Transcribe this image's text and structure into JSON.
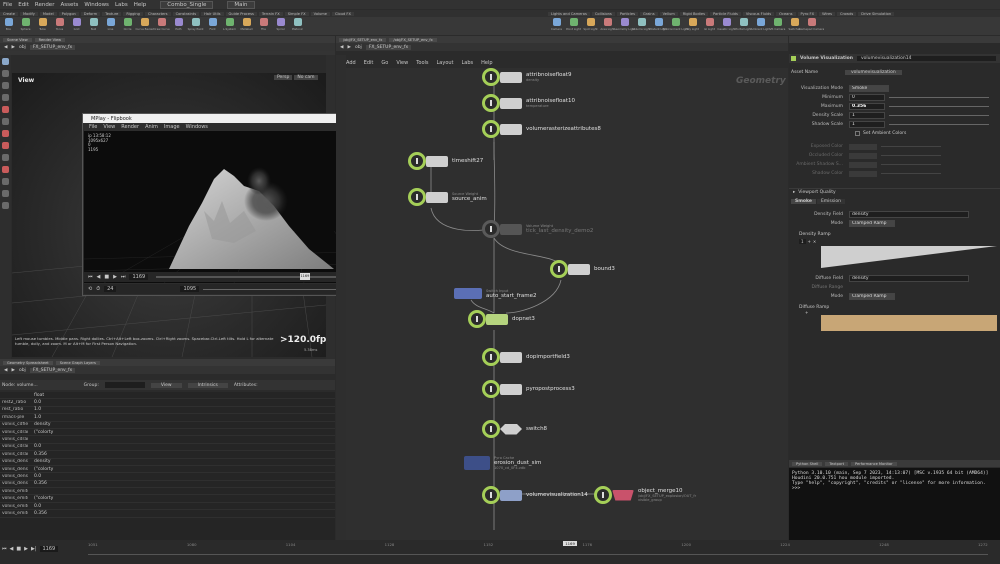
{
  "menubar": {
    "items": [
      "File",
      "Edit",
      "Render",
      "Assets",
      "Windows",
      "Labs",
      "Help"
    ],
    "desktop": "Combo_Single",
    "workspace": "Main"
  },
  "shelf_left": {
    "tabs": [
      "Create",
      "Modify",
      "Model",
      "Polygon",
      "Deform",
      "Texture",
      "Rigging",
      "Characters",
      "Constraints",
      "Hair Utils",
      "Guide Process",
      "Terrain FX",
      "Simple FX",
      "Volume",
      "Cloud FX"
    ],
    "tools": [
      "Box",
      "Sphere",
      "Tube",
      "Torus",
      "Grid",
      "Null",
      "Line",
      "Circle",
      "Curve Bezier",
      "Draw Curve",
      "Path",
      "Spray Paint",
      "Font",
      "L-System",
      "Metaball",
      "File",
      "Spiral",
      "Platonic"
    ]
  },
  "shelf_right": {
    "tabs": [
      "Lights and Cameras",
      "Collisions",
      "Particles",
      "Grains",
      "Vellum",
      "Rigid Bodies",
      "Particle Fluids",
      "Viscous Fluids",
      "Oceans",
      "Pyro FX",
      "Wires",
      "Crowds",
      "Drive Simulation"
    ],
    "tools": [
      "Camera",
      "Point Light",
      "Spot Light",
      "Area Light",
      "Geometry Light",
      "Volume Light",
      "Distant Light",
      "Environment Light",
      "Sky Light",
      "GI Light",
      "Caustic Light",
      "Portal Light",
      "Ambient Light",
      "VR Camera",
      "Switcher",
      "Gamepad Camera"
    ]
  },
  "left_pane": {
    "tabs": [
      "Scene View",
      "Render View"
    ],
    "path_root": "obj",
    "path_net": "FX_SETUP_env_fx",
    "view_title": "View",
    "persp": "Persp",
    "nocam": "No cam",
    "hint": "Left mouse tumbles. Middle pans. Right dollies. Ctrl+Alt+Left box-zooms. Ctrl+Right zooms. Spacebar-Ctrl-Left tilts. Hold L for alternate tumble, dolly, and zoom. M or Alt+M for First Person Navigation.",
    "fps": ">120.0fps",
    "fps_sub": "5.38ms"
  },
  "flipbook": {
    "title": "MPlay - Flipbook",
    "menu": [
      "File",
      "View",
      "Render",
      "Anim",
      "Image",
      "Windows"
    ],
    "info": [
      "ip 13:58:12",
      "1095x627",
      "0",
      "1195"
    ],
    "frame": "1169",
    "frame_fine": "1169",
    "step": "24",
    "start": "1095",
    "end": "1156"
  },
  "spreadsheet": {
    "tabs": [
      "Geometry Spreadsheet",
      "Scene Graph Layers"
    ],
    "path_root": "obj",
    "path_net": "FX_SETUP_env_fx",
    "node_label": "Node: volume...",
    "group_label": "Group:",
    "view_label": "View",
    "intrinsics_label": "Intrinsics",
    "attributes_label": "Attributes:",
    "type_col": "float",
    "rows": [
      [
        "rest2_ratio",
        "0.0"
      ],
      [
        "rest_ratio",
        "1.0"
      ],
      [
        "rmacs-ple",
        "1.0"
      ],
      [
        "volvis_cdfield",
        "density"
      ],
      [
        "volvis_cdramp",
        "(\"colorty"
      ],
      [
        "volvis_cdrampr",
        ""
      ],
      [
        "volvis_cdrangel",
        "0.0"
      ],
      [
        "volvis_cdrangel",
        "0.356"
      ],
      [
        "volvis_densityfi",
        "density"
      ],
      [
        "volvis_densityra",
        "(\"colorty"
      ],
      [
        "volvis_densityra",
        "0.0"
      ],
      [
        "volvis_densityra",
        "0.356"
      ],
      [
        "volvis_emitcdfie",
        ""
      ],
      [
        "volvis_emitcdra",
        "(\"colorty"
      ],
      [
        "volvis_emitcdra",
        "0.0"
      ],
      [
        "volvis_emitcdra",
        "0.356"
      ]
    ]
  },
  "network": {
    "tabs": [
      "/obj/FX_SETUP_env_fx",
      "/obj/FX_SETUP_env_fx"
    ],
    "path_root": "obj",
    "path_net": "FX_SETUP_env_fx",
    "menu": [
      "Add",
      "Edit",
      "Go",
      "View",
      "Tools",
      "Layout",
      "Labs",
      "Help"
    ],
    "context": "Geometry",
    "nodes": [
      {
        "label": "attribnoisefloat9",
        "sub": "density"
      },
      {
        "label": "attribnoisefloat10",
        "sub": "temperature"
      },
      {
        "label": "volumerasterizeattributes8",
        "sub": ""
      },
      {
        "label": "timeshift27",
        "sub": ""
      },
      {
        "label": "source_anim",
        "sub": "Source Weight"
      },
      {
        "label": "tick_last_density_demo2",
        "sub": "Volume Weight"
      },
      {
        "label": "bound3",
        "sub": ""
      },
      {
        "label": "auto_start_frame2",
        "sub": "Switch Input"
      },
      {
        "label": "dopnet3",
        "sub": ""
      },
      {
        "label": "dopimportfield3",
        "sub": ""
      },
      {
        "label": "pyropostprocess3",
        "sub": ""
      },
      {
        "label": "switch8",
        "sub": ""
      },
      {
        "label": "erosion_dust_sim",
        "sub": "Pyro Cache",
        "extra": "1070_cd_0F4.vdb"
      },
      {
        "label": "volumevisualization14",
        "sub": ""
      },
      {
        "label": "object_merge10",
        "sub": "/obj/FX_SETUP_explosion/OUT_fr",
        "extra": "visible_group"
      }
    ]
  },
  "params": {
    "node_type": "Volume Visualization",
    "node_name": "volumevisualization14",
    "asset_name_label": "Asset Name",
    "asset_name": "volumevisualization",
    "vis_mode_label": "Visualization Mode",
    "vis_mode": "Smoke",
    "minimum_label": "Minimum",
    "minimum": "0",
    "maximum_label": "Maximum",
    "maximum": "0.356",
    "density_scale_label": "Density Scale",
    "density_scale": "1",
    "shadow_scale_label": "Shadow Scale",
    "shadow_scale": "1",
    "set_ambient_label": "Set Ambient Colors",
    "disabled_rows": [
      "Exposed Color",
      "Occluded Color",
      "Ambient Shadow S...",
      "Shadow Color"
    ],
    "viewport_quality_label": "Viewport Quality",
    "tabs": [
      "Smoke",
      "Emission"
    ],
    "density_field_label": "Density Field",
    "density_field": "density",
    "mode_label": "Mode",
    "mode_value": "Clamped Ramp",
    "density_ramp_label": "Density Ramp",
    "ramp_idx": "1",
    "diffuse_field_label": "Diffuse Field",
    "diffuse_field": "density",
    "diffuse_range_label": "Diffuse Range",
    "mode2_value": "Clamped Ramp",
    "diffuse_ramp_label": "Diffuse Ramp",
    "diffuse_color": "#c8a676"
  },
  "python": {
    "tabs": [
      "Python Shell",
      "Textport",
      "Performance Monitor"
    ],
    "lines": [
      "Python 3.10.10 (main, Sep 7 2023, 14:13:07) [MSC v.1935 64 bit (AMD64)]",
      "Houdini 20.0.751 hou module imported.",
      "Type \"help\", \"copyright\", \"credits\" or \"license\" for more information.",
      ">>>"
    ]
  },
  "timeline": {
    "current_frame": "1169",
    "ticks": [
      "1051",
      "1080",
      "1104",
      "1128",
      "1152",
      "1176",
      "1200",
      "1224",
      "1248",
      "1272"
    ],
    "marker": "1169"
  }
}
